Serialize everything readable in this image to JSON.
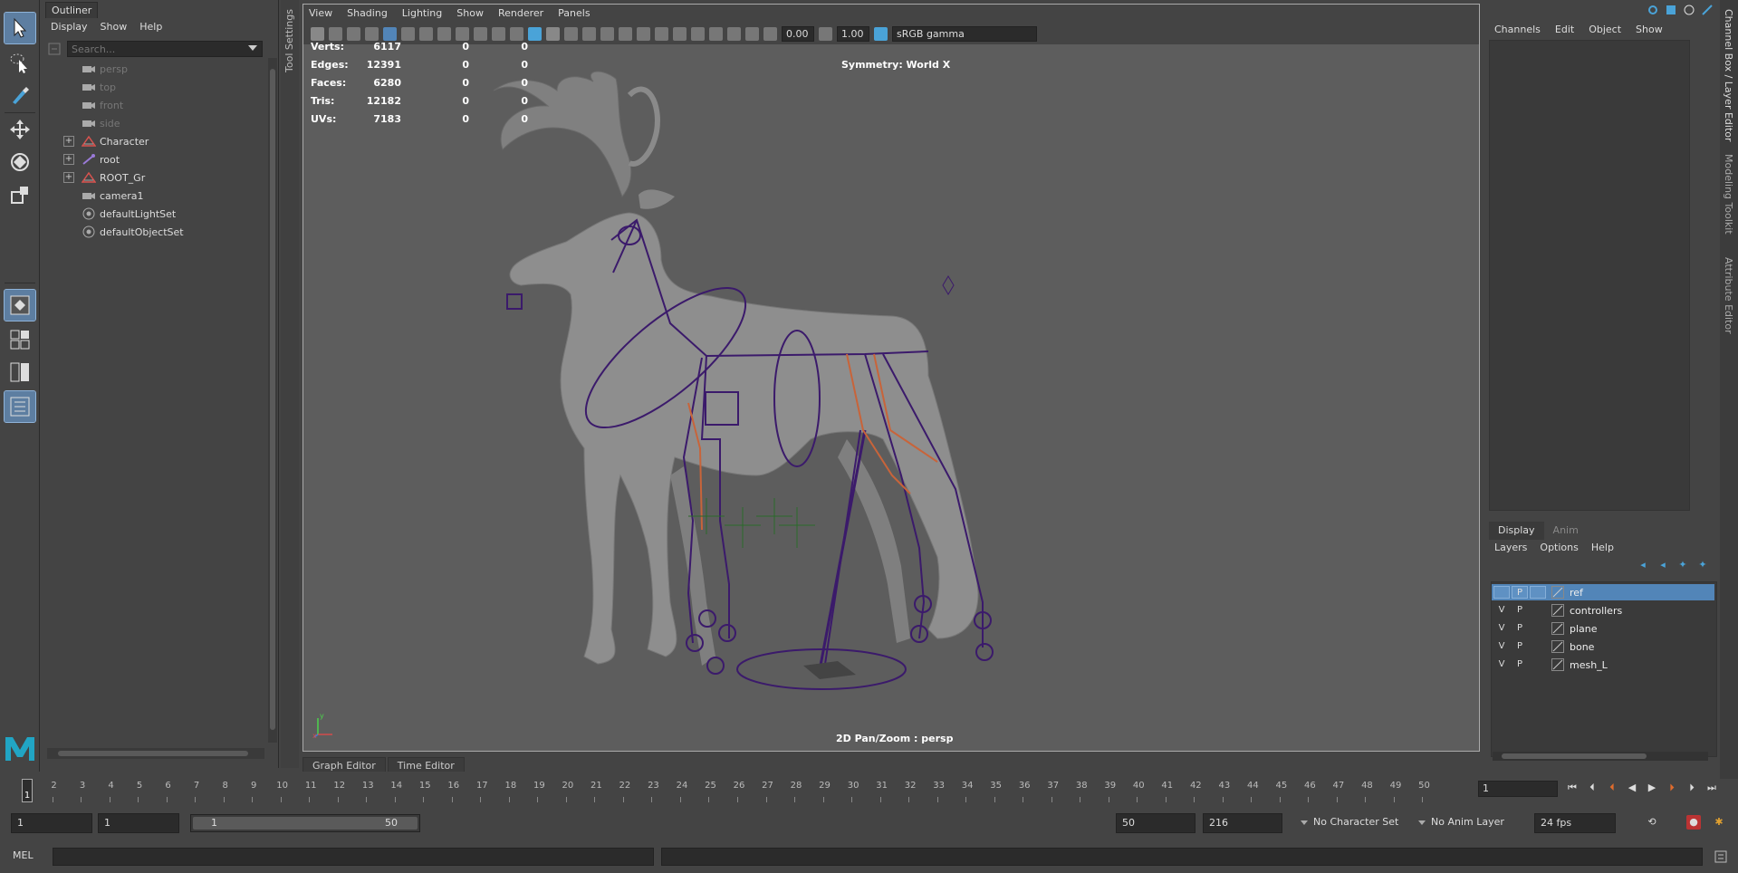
{
  "colors": {
    "accent": "#5285b8",
    "rig_purple": "#3b1a6b",
    "rig_orange": "#c8643a",
    "viewport_bg": "#5d5d5d",
    "logo": "#21a5c4"
  },
  "outliner": {
    "tab_label": "Outliner",
    "menu": [
      "Display",
      "Show",
      "Help"
    ],
    "search_placeholder": "Search...",
    "items": [
      {
        "label": "persp",
        "icon": "camera-icon",
        "dim": true
      },
      {
        "label": "top",
        "icon": "camera-icon",
        "dim": true
      },
      {
        "label": "front",
        "icon": "camera-icon",
        "dim": true
      },
      {
        "label": "side",
        "icon": "camera-icon",
        "dim": true
      },
      {
        "label": "Character",
        "icon": "group-icon",
        "expandable": true
      },
      {
        "label": "root",
        "icon": "joint-icon",
        "expandable": true
      },
      {
        "label": "ROOT_Gr",
        "icon": "group-icon",
        "expandable": true
      },
      {
        "label": "camera1",
        "icon": "camera-icon"
      },
      {
        "label": "defaultLightSet",
        "icon": "set-icon"
      },
      {
        "label": "defaultObjectSet",
        "icon": "set-icon"
      }
    ]
  },
  "tool_settings_label": "Tool Settings",
  "viewport": {
    "menu": [
      "View",
      "Shading",
      "Lighting",
      "Show",
      "Renderer",
      "Panels"
    ],
    "exposure": "0.00",
    "gamma": "1.00",
    "color_space": "sRGB gamma",
    "hud": [
      {
        "label": "Verts:",
        "v1": "6117",
        "v2": "0",
        "v3": "0"
      },
      {
        "label": "Edges:",
        "v1": "12391",
        "v2": "0",
        "v3": "0"
      },
      {
        "label": "Faces:",
        "v1": "6280",
        "v2": "0",
        "v3": "0"
      },
      {
        "label": "Tris:",
        "v1": "12182",
        "v2": "0",
        "v3": "0"
      },
      {
        "label": "UVs:",
        "v1": "7183",
        "v2": "0",
        "v3": "0"
      }
    ],
    "symmetry": "Symmetry: World X",
    "panzoom": "2D Pan/Zoom : persp",
    "axis_y": "y",
    "axis_x": "x"
  },
  "channelbox": {
    "menu": [
      "Channels",
      "Edit",
      "Object",
      "Show"
    ]
  },
  "right_tabs": [
    "Channel Box / Layer Editor",
    "Modeling Toolkit",
    "Attribute Editor"
  ],
  "layer_editor": {
    "tabs": [
      "Display",
      "Anim"
    ],
    "menu": [
      "Layers",
      "Options",
      "Help"
    ],
    "layers": [
      {
        "name": "ref",
        "v": "",
        "p": "P",
        "selected": true
      },
      {
        "name": "controllers",
        "v": "V",
        "p": "P"
      },
      {
        "name": "plane",
        "v": "V",
        "p": "P"
      },
      {
        "name": "bone",
        "v": "V",
        "p": "P"
      },
      {
        "name": "mesh_L",
        "v": "V",
        "p": "P"
      }
    ]
  },
  "editor_tabs": [
    "Graph Editor",
    "Time Editor"
  ],
  "timeline": {
    "start": 1,
    "end": 50,
    "current": "1",
    "current_frame_field": "1"
  },
  "range": {
    "start_field": "1",
    "playback_start": "1",
    "range_left": "1",
    "range_right": "50",
    "playback_end": "50",
    "end_field": "216",
    "character_set": "No Character Set",
    "anim_layer": "No Anim Layer",
    "fps": "24 fps"
  },
  "mel_label": "MEL"
}
